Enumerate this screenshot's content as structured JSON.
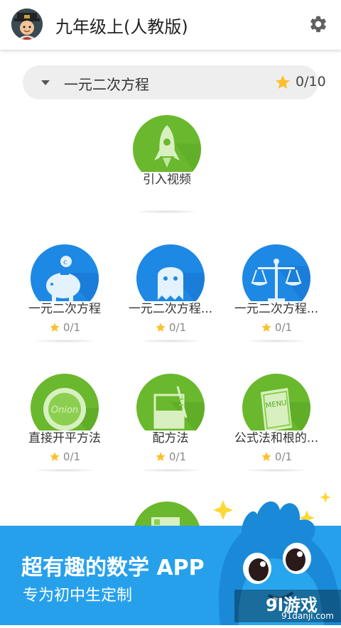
{
  "header": {
    "title": "九年级上(人教版)",
    "avatar_icon": "user-avatar",
    "settings_icon": "gear-icon"
  },
  "chapter": {
    "label": "一元二次方程",
    "score": "0/10"
  },
  "intro": {
    "name": "引入视频",
    "icon": "rocket-icon"
  },
  "lessons": [
    {
      "name": "一元二次方程",
      "progress": "0/1",
      "icon": "piggy-bank-icon",
      "color": "#1e88e5"
    },
    {
      "name": "一元二次方程...",
      "progress": "0/1",
      "icon": "ghost-icon",
      "color": "#1e88e5"
    },
    {
      "name": "一元二次方程...",
      "progress": "0/1",
      "icon": "balance-scale-icon",
      "color": "#1e88e5"
    },
    {
      "name": "直接开平方法",
      "progress": "0/1",
      "icon": "onion-cap-icon",
      "color": "#6ab82d"
    },
    {
      "name": "配方法",
      "progress": "0/1",
      "icon": "beaker-icon",
      "color": "#6ab82d"
    },
    {
      "name": "公式法和根的...",
      "progress": "0/1",
      "icon": "menu-book-icon",
      "color": "#6ab82d"
    }
  ],
  "banner": {
    "headline": "超有趣的数学 APP",
    "subline": "专为初中生定制"
  },
  "watermark": {
    "brand": "9l游戏",
    "url": "91danji.com"
  },
  "colors": {
    "blue": "#1e88e5",
    "green": "#6ab82d",
    "banner": "#27a0ec",
    "star": "#fbc02d"
  }
}
